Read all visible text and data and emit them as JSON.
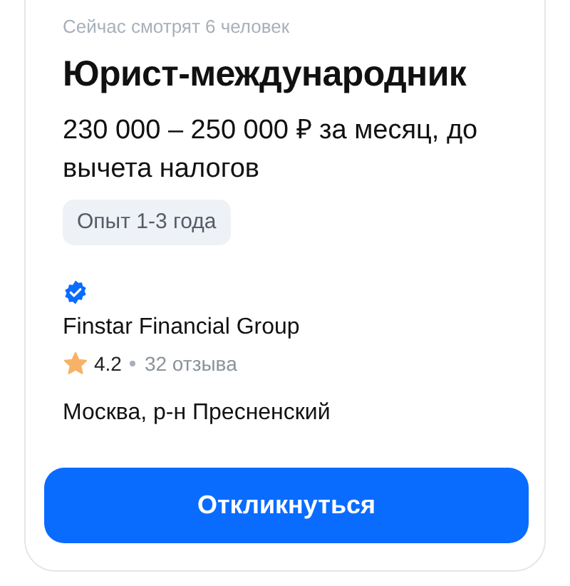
{
  "viewers": "Сейчас смотрят 6 человек",
  "title": "Юрист-международник",
  "salary": "230 000 – 250 000 ₽ за месяц, до вычета налогов",
  "experience": "Опыт 1-3 года",
  "company": {
    "verified": true,
    "name": "Finstar Financial Group",
    "rating": "4.2",
    "reviews": "32 отзыва"
  },
  "location": "Москва, р-н Пресненский",
  "apply_button": "Откликнуться"
}
